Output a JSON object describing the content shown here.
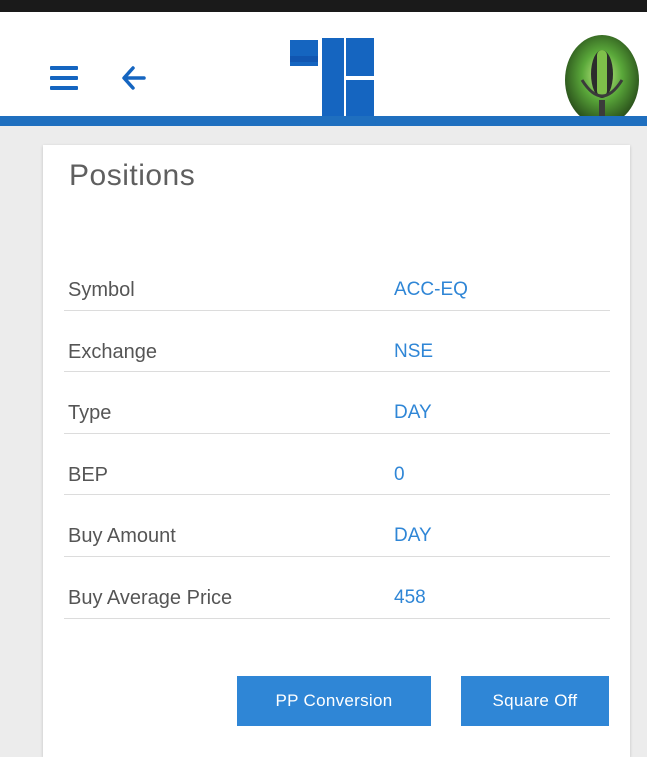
{
  "header": {
    "menu_icon": "hamburger-menu-icon",
    "back_icon": "arrow-left-icon",
    "collapse_icon": "chevron-down-icon",
    "brand_color": "#1f6fbf"
  },
  "positions": {
    "title": "Positions",
    "rows": [
      {
        "label": "Symbol",
        "value": "ACC-EQ"
      },
      {
        "label": "Exchange",
        "value": "NSE"
      },
      {
        "label": "Type",
        "value": "DAY"
      },
      {
        "label": "BEP",
        "value": "0"
      },
      {
        "label": "Buy Amount",
        "value": "DAY"
      },
      {
        "label": "Buy Average Price",
        "value": "458"
      }
    ],
    "buttons": {
      "conversion": "PP Conversion",
      "square_off": "Square Off"
    },
    "accent_color": "#2f86d6"
  }
}
